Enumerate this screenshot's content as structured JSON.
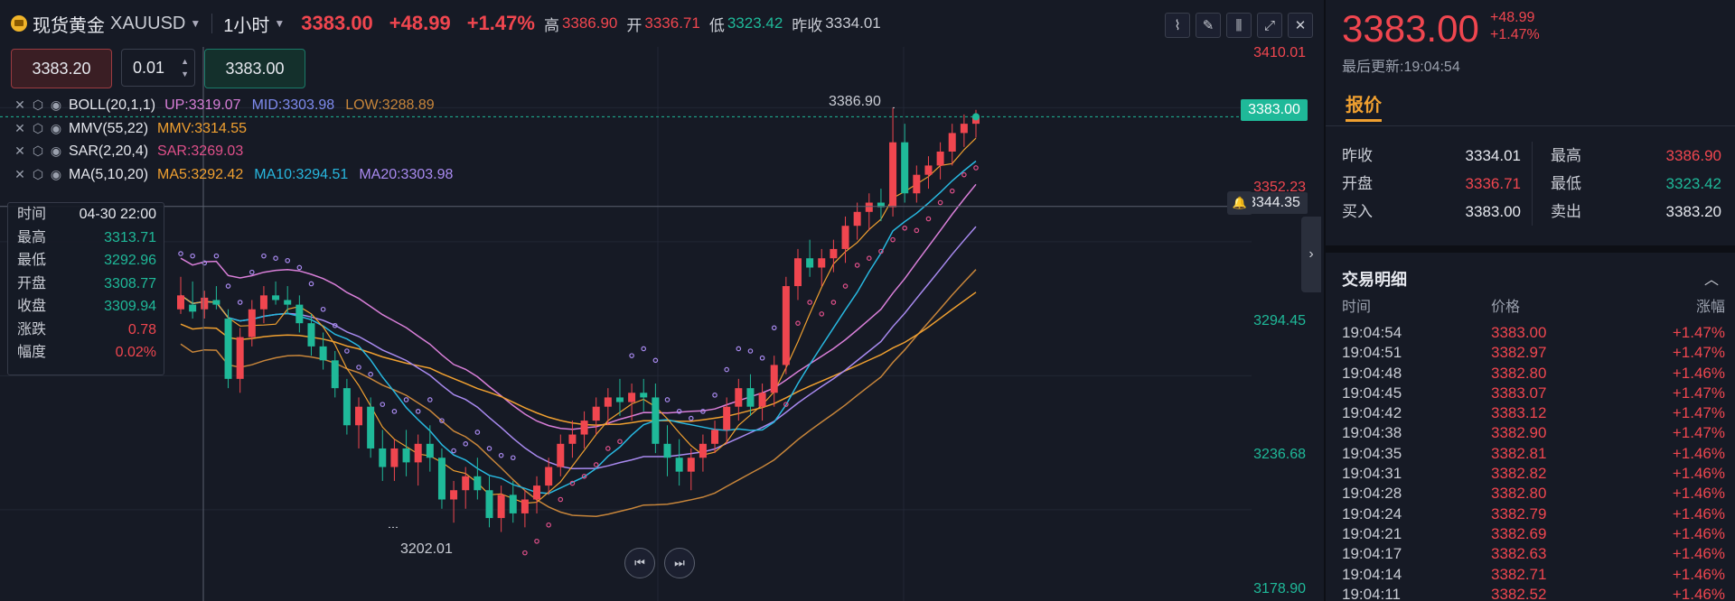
{
  "header": {
    "symbol_name": "现货黄金",
    "symbol_code": "XAUUSD",
    "interval": "1小时",
    "price": "3383.00",
    "change": "+48.99",
    "change_pct": "+1.47%",
    "high_label": "高",
    "high": "3386.90",
    "open_label": "开",
    "open": "3336.71",
    "low_label": "低",
    "low": "3323.42",
    "prev_label": "昨收",
    "prev": "3334.01"
  },
  "order": {
    "sell_price": "3383.20",
    "quantity": "0.01",
    "buy_price": "3383.00"
  },
  "indicators": [
    {
      "name": "BOLL(20,1,1)",
      "values": [
        {
          "label": "UP:3319.07",
          "color": "#d97fd9"
        },
        {
          "label": "MID:3303.98",
          "color": "#7f8cf0"
        },
        {
          "label": "LOW:3288.89",
          "color": "#c7853a"
        }
      ]
    },
    {
      "name": "MMV(55,22)",
      "values": [
        {
          "label": "MMV:3314.55",
          "color": "#f0a030"
        }
      ]
    },
    {
      "name": "SAR(2,20,4)",
      "values": [
        {
          "label": "SAR:3269.03",
          "color": "#e0508a"
        }
      ]
    },
    {
      "name": "MA(5,10,20)",
      "values": [
        {
          "label": "MA5:3292.42",
          "color": "#f0a030"
        },
        {
          "label": "MA10:3294.51",
          "color": "#28b8e0"
        },
        {
          "label": "MA20:3303.98",
          "color": "#a98af0"
        }
      ]
    }
  ],
  "tooltip": [
    {
      "label": "时间",
      "value": "04-30 22:00"
    },
    {
      "label": "最高",
      "value": "3313.71"
    },
    {
      "label": "最低",
      "value": "3292.96"
    },
    {
      "label": "开盘",
      "value": "3308.77"
    },
    {
      "label": "收盘",
      "value": "3309.94"
    },
    {
      "label": "涨跌",
      "value": "0.78"
    },
    {
      "label": "幅度",
      "value": "0.02%"
    }
  ],
  "axis_labels": [
    "3410.01",
    "3352.23",
    "3294.45",
    "3236.68",
    "3178.90"
  ],
  "axis_label_values": [
    3410.01,
    3352.23,
    3294.45,
    3236.68,
    3178.9
  ],
  "price_tag": "3383.00",
  "crosshair_tag": "3344.35",
  "high_annotation": "3386.90",
  "low_annotation": "3202.01",
  "chart_data": {
    "type": "candlestick",
    "ylim": [
      3178.9,
      3410.01
    ],
    "candles": [
      [
        3300,
        3314,
        3298,
        3306
      ],
      [
        3302,
        3312,
        3296,
        3299
      ],
      [
        3300,
        3308,
        3296,
        3305
      ],
      [
        3304,
        3310,
        3300,
        3302
      ],
      [
        3296,
        3300,
        3266,
        3270
      ],
      [
        3270,
        3292,
        3264,
        3288
      ],
      [
        3288,
        3304,
        3284,
        3300
      ],
      [
        3300,
        3310,
        3294,
        3306
      ],
      [
        3306,
        3312,
        3302,
        3304
      ],
      [
        3304,
        3310,
        3298,
        3302
      ],
      [
        3302,
        3306,
        3290,
        3294
      ],
      [
        3294,
        3298,
        3280,
        3284
      ],
      [
        3284,
        3290,
        3274,
        3278
      ],
      [
        3278,
        3282,
        3262,
        3266
      ],
      [
        3266,
        3270,
        3246,
        3250
      ],
      [
        3250,
        3262,
        3240,
        3258
      ],
      [
        3258,
        3262,
        3236,
        3240
      ],
      [
        3240,
        3248,
        3226,
        3232
      ],
      [
        3232,
        3244,
        3226,
        3240
      ],
      [
        3240,
        3248,
        3228,
        3234
      ],
      [
        3234,
        3246,
        3224,
        3242
      ],
      [
        3242,
        3250,
        3230,
        3236
      ],
      [
        3236,
        3240,
        3214,
        3218
      ],
      [
        3218,
        3226,
        3208,
        3222
      ],
      [
        3222,
        3232,
        3214,
        3228
      ],
      [
        3228,
        3236,
        3218,
        3222
      ],
      [
        3222,
        3228,
        3206,
        3210
      ],
      [
        3210,
        3224,
        3204,
        3220
      ],
      [
        3220,
        3226,
        3208,
        3212
      ],
      [
        3212,
        3222,
        3206,
        3218
      ],
      [
        3218,
        3228,
        3212,
        3224
      ],
      [
        3224,
        3236,
        3220,
        3232
      ],
      [
        3232,
        3246,
        3228,
        3242
      ],
      [
        3242,
        3252,
        3236,
        3246
      ],
      [
        3246,
        3256,
        3240,
        3252
      ],
      [
        3252,
        3262,
        3246,
        3258
      ],
      [
        3258,
        3266,
        3250,
        3262
      ],
      [
        3262,
        3270,
        3254,
        3260
      ],
      [
        3260,
        3268,
        3252,
        3264
      ],
      [
        3264,
        3270,
        3256,
        3262
      ],
      [
        3262,
        3268,
        3238,
        3242
      ],
      [
        3242,
        3250,
        3228,
        3236
      ],
      [
        3236,
        3244,
        3224,
        3230
      ],
      [
        3230,
        3240,
        3222,
        3236
      ],
      [
        3236,
        3246,
        3230,
        3242
      ],
      [
        3242,
        3252,
        3238,
        3248
      ],
      [
        3248,
        3262,
        3242,
        3258
      ],
      [
        3258,
        3270,
        3252,
        3266
      ],
      [
        3266,
        3272,
        3254,
        3258
      ],
      [
        3258,
        3268,
        3252,
        3264
      ],
      [
        3264,
        3280,
        3258,
        3276
      ],
      [
        3276,
        3314,
        3272,
        3310
      ],
      [
        3310,
        3326,
        3304,
        3322
      ],
      [
        3322,
        3330,
        3314,
        3318
      ],
      [
        3318,
        3326,
        3310,
        3322
      ],
      [
        3322,
        3330,
        3316,
        3326
      ],
      [
        3326,
        3340,
        3320,
        3336
      ],
      [
        3336,
        3346,
        3330,
        3342
      ],
      [
        3342,
        3350,
        3334,
        3346
      ],
      [
        3346,
        3352,
        3338,
        3344
      ],
      [
        3344,
        3386.9,
        3340,
        3372
      ],
      [
        3372,
        3380,
        3346,
        3350
      ],
      [
        3350,
        3362,
        3346,
        3358
      ],
      [
        3358,
        3366,
        3352,
        3362
      ],
      [
        3362,
        3372,
        3356,
        3368
      ],
      [
        3368,
        3380,
        3362,
        3376
      ],
      [
        3376,
        3384,
        3370,
        3380
      ],
      [
        3380,
        3386,
        3374,
        3383
      ]
    ]
  },
  "right": {
    "price": "3383.00",
    "change": "+48.99",
    "change_pct": "+1.47%",
    "updated": "最后更新:19:04:54",
    "tab": "报价",
    "quote": [
      [
        {
          "label": "昨收",
          "value": "3334.01",
          "color": ""
        },
        {
          "label": "最高",
          "value": "3386.90",
          "color": "red"
        }
      ],
      [
        {
          "label": "开盘",
          "value": "3336.71",
          "color": "red"
        },
        {
          "label": "最低",
          "value": "3323.42",
          "color": "green"
        }
      ],
      [
        {
          "label": "买入",
          "value": "3383.00",
          "color": ""
        },
        {
          "label": "卖出",
          "value": "3383.20",
          "color": ""
        }
      ]
    ],
    "trades_title": "交易明细",
    "trades_head": {
      "time": "时间",
      "price": "价格",
      "chg": "涨幅"
    },
    "trades": [
      {
        "time": "19:04:54",
        "price": "3383.00",
        "chg": "+1.47%"
      },
      {
        "time": "19:04:51",
        "price": "3382.97",
        "chg": "+1.47%"
      },
      {
        "time": "19:04:48",
        "price": "3382.80",
        "chg": "+1.46%"
      },
      {
        "time": "19:04:45",
        "price": "3383.07",
        "chg": "+1.47%"
      },
      {
        "time": "19:04:42",
        "price": "3383.12",
        "chg": "+1.47%"
      },
      {
        "time": "19:04:38",
        "price": "3382.90",
        "chg": "+1.47%"
      },
      {
        "time": "19:04:35",
        "price": "3382.81",
        "chg": "+1.46%"
      },
      {
        "time": "19:04:31",
        "price": "3382.82",
        "chg": "+1.46%"
      },
      {
        "time": "19:04:28",
        "price": "3382.80",
        "chg": "+1.46%"
      },
      {
        "time": "19:04:24",
        "price": "3382.79",
        "chg": "+1.46%"
      },
      {
        "time": "19:04:21",
        "price": "3382.69",
        "chg": "+1.46%"
      },
      {
        "time": "19:04:17",
        "price": "3382.63",
        "chg": "+1.46%"
      },
      {
        "time": "19:04:14",
        "price": "3382.71",
        "chg": "+1.46%"
      },
      {
        "time": "19:04:11",
        "price": "3382.52",
        "chg": "+1.46%"
      }
    ]
  },
  "colors": {
    "up": "#f0464f",
    "down": "#1fb999",
    "accent": "#f0a030"
  }
}
